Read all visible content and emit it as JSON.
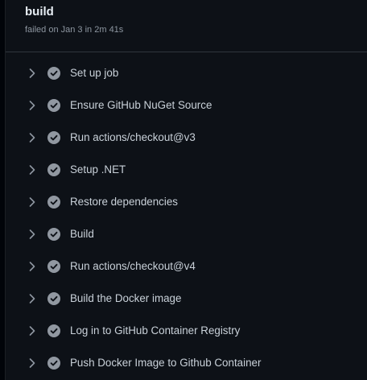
{
  "job": {
    "title": "build",
    "status": "failed on Jan 3 in 2m 41s"
  },
  "steps": [
    {
      "label": "Set up job",
      "status": "success"
    },
    {
      "label": "Ensure GitHub NuGet Source",
      "status": "success"
    },
    {
      "label": "Run actions/checkout@v3",
      "status": "success"
    },
    {
      "label": "Setup .NET",
      "status": "success"
    },
    {
      "label": "Restore dependencies",
      "status": "success"
    },
    {
      "label": "Build",
      "status": "success"
    },
    {
      "label": "Run actions/checkout@v4",
      "status": "success"
    },
    {
      "label": "Build the Docker image",
      "status": "success"
    },
    {
      "label": "Log in to GitHub Container Registry",
      "status": "success"
    },
    {
      "label": "Push Docker Image to Github Container",
      "status": "success"
    }
  ],
  "icons": {
    "expand": "chevron-right-icon",
    "success": "check-circle-fill-icon"
  },
  "colors": {
    "background": "#0d1117",
    "success_icon": "#9198a1",
    "text": "#c9d1d9",
    "muted": "#8d96a0"
  }
}
